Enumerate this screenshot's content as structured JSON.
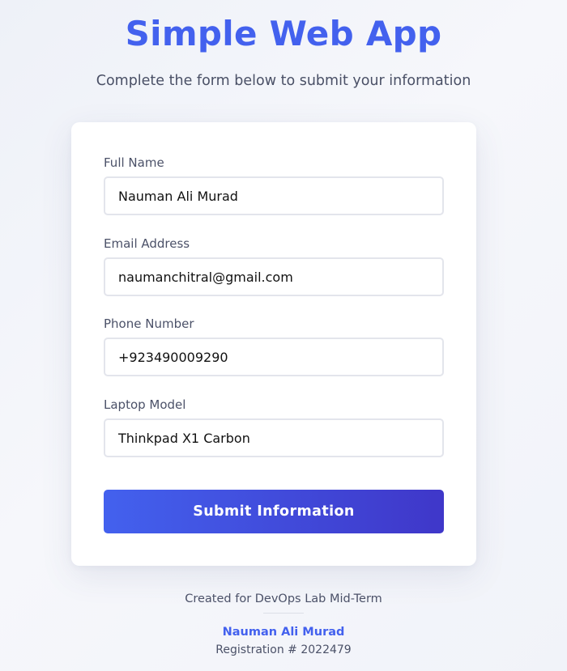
{
  "header": {
    "title": "Simple Web App",
    "subtitle": "Complete the form below to submit your information"
  },
  "form": {
    "fields": [
      {
        "label": "Full Name",
        "value": "Nauman Ali Murad"
      },
      {
        "label": "Email Address",
        "value": "naumanchitral@gmail.com"
      },
      {
        "label": "Phone Number",
        "value": "+923490009290"
      },
      {
        "label": "Laptop Model",
        "value": "Thinkpad X1 Carbon"
      }
    ],
    "submit_label": "Submit Information"
  },
  "footer": {
    "note": "Created for DevOps Lab Mid-Term",
    "author": "Nauman Ali Murad",
    "registration": "Registration # 2022479"
  },
  "colors": {
    "accent": "#4361ee",
    "accent_dark": "#3f37c9",
    "text_muted": "#4b5168",
    "card_bg": "#ffffff"
  }
}
